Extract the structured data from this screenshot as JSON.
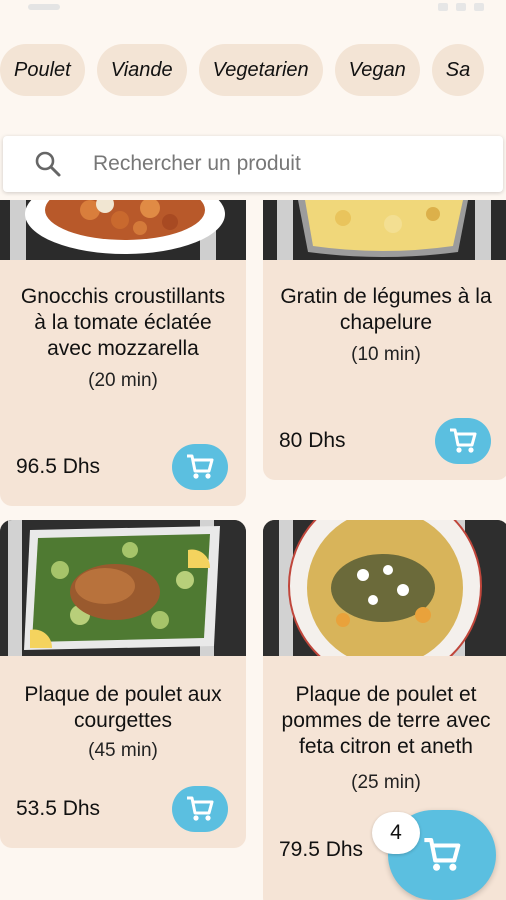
{
  "categories": [
    "Poulet",
    "Viande",
    "Vegetarien",
    "Vegan",
    "Sa"
  ],
  "search": {
    "placeholder": "Rechercher un produit"
  },
  "products": [
    {
      "title": "Gnocchis croustillants à la tomate éclatée avec mozzarella",
      "time": "(20 min)",
      "price": "96.5 Dhs"
    },
    {
      "title": "Gratin de légumes à la chapelure",
      "time": "(10 min)",
      "price": "80 Dhs"
    },
    {
      "title": "Plaque de poulet aux courgettes",
      "time": "(45 min)",
      "price": "53.5 Dhs"
    },
    {
      "title": "Plaque de poulet et pommes de terre avec feta citron et aneth",
      "time": "(25 min)",
      "price": "79.5 Dhs"
    }
  ],
  "cart": {
    "count": "4"
  },
  "colors": {
    "accent": "#5bbfe0",
    "card": "#f5e4d6",
    "chip": "#f3e4d5",
    "background": "#fdf7f1"
  },
  "icons": [
    "search-icon",
    "cart-icon"
  ]
}
